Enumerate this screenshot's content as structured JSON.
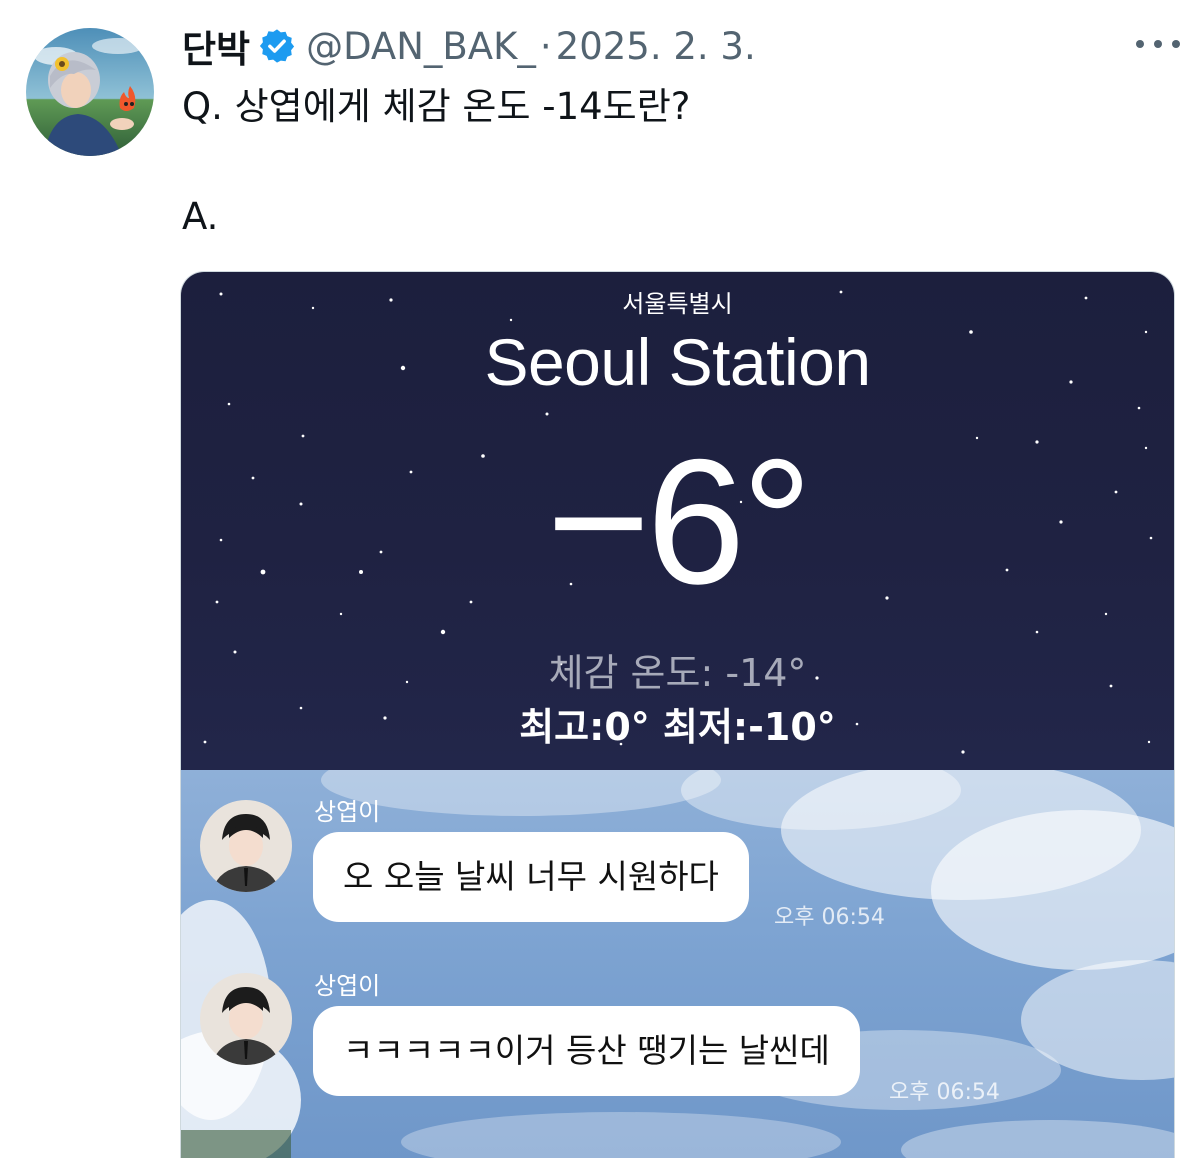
{
  "tweet": {
    "display_name": "단박",
    "handle": "@DAN_BAK_",
    "separator": "·",
    "date": "2025. 2. 3.",
    "text_lines": [
      "Q. 상엽에게 체감 온도 -14도란?",
      "A."
    ],
    "more_icon": "more-horizontal-icon",
    "verified_icon": "verified-badge-icon"
  },
  "weather": {
    "city": "서울특별시",
    "station": "Seoul Station",
    "temperature": "−6°",
    "feels_like": "체감 온도: -14°",
    "high_low": "최고:0°  최저:-10°"
  },
  "chat": {
    "messages": [
      {
        "sender": "상엽이",
        "text": "오 오늘 날씨 너무 시원하다",
        "time": "오후 06:54"
      },
      {
        "sender": "상엽이",
        "text": "ㅋㅋㅋㅋㅋ이거 등산 땡기는 날씬데",
        "time": "오후 06:54"
      }
    ]
  },
  "colors": {
    "text_primary": "#0f1419",
    "text_secondary": "#536471",
    "verified_blue": "#1d9bf0",
    "weather_bg": "#1f2242",
    "sky_bg": "#7ea4d2"
  }
}
